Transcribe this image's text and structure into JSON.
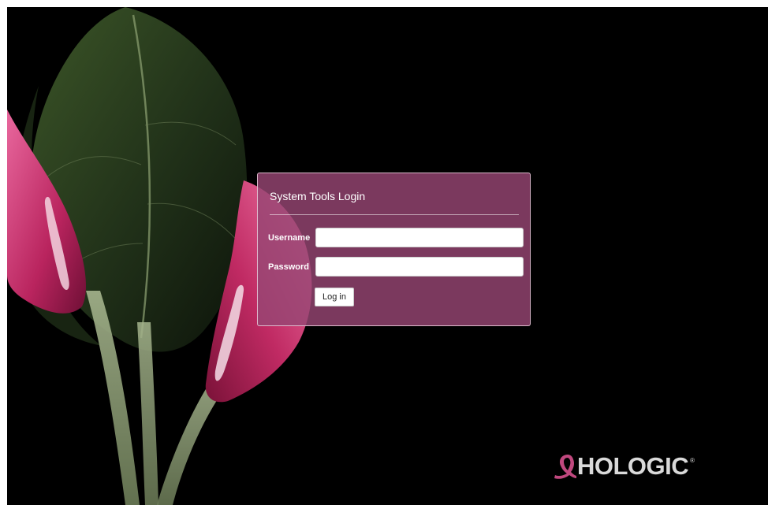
{
  "login": {
    "title": "System Tools Login",
    "username_label": "Username",
    "username_value": "",
    "password_label": "Password",
    "password_value": "",
    "submit_label": "Log in"
  },
  "brand": {
    "logo_text": "HOLOGIC",
    "registered_mark": "®",
    "ribbon_color": "#c0487e",
    "text_color": "#d9d9d9"
  },
  "background": {
    "color": "#000000",
    "image": "calla-lily-xray"
  },
  "colors": {
    "panel": "#964673",
    "panel_border": "#e6c8d7"
  }
}
